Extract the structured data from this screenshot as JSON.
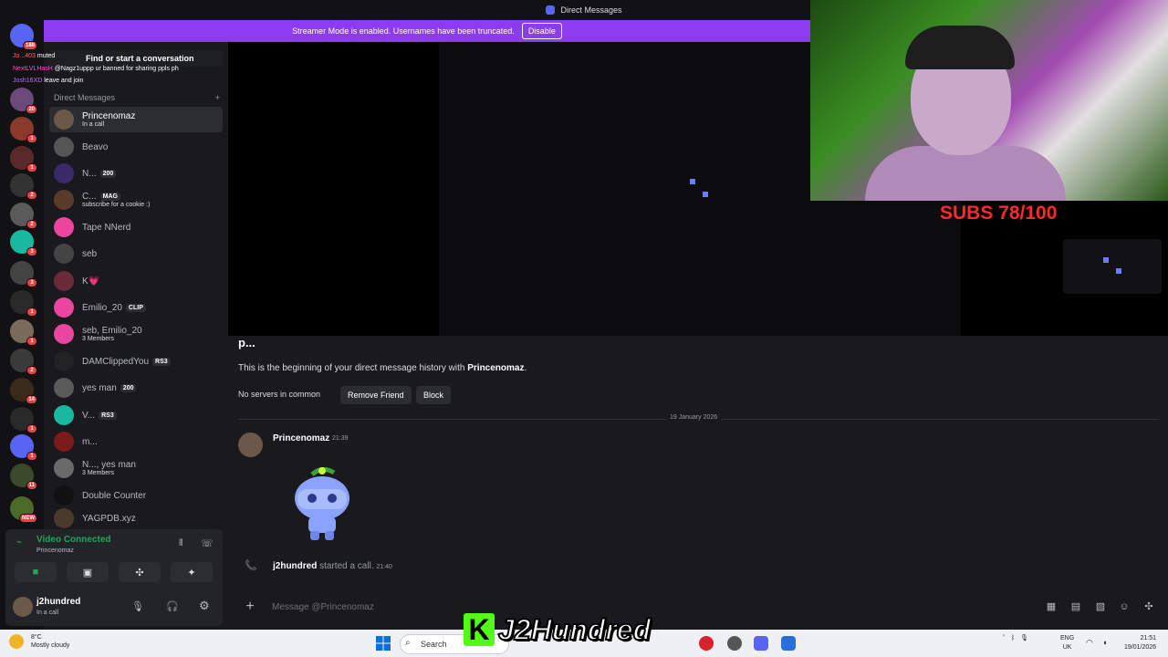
{
  "window": {
    "title": "Direct Messages"
  },
  "streamer_banner": {
    "text": "Streamer Mode is enabled. Usernames have been truncated.",
    "button": "Disable",
    "color": "#8c3bf0"
  },
  "rail": {
    "home_badge": "188",
    "servers": [
      {
        "badge": "20",
        "color": "#6b4a7a"
      },
      {
        "badge": "1",
        "color": "#8a3a2a"
      },
      {
        "badge": "1",
        "color": "#5a2a2a"
      },
      {
        "badge": "2",
        "color": "#333333"
      },
      {
        "badge": "2",
        "color": "#5a5a5a"
      },
      {
        "badge": "3",
        "color": "#19b8a0"
      },
      {
        "badge": "3",
        "color": "#444444"
      },
      {
        "badge": "1",
        "color": "#2a2a2a"
      },
      {
        "badge": "1",
        "color": "#7a6a5a"
      },
      {
        "badge": "2",
        "color": "#3a3a3a"
      },
      {
        "badge": "14",
        "color": "#3a2a1a"
      },
      {
        "badge": "1",
        "color": "#2a2a2a"
      },
      {
        "badge": "1",
        "color": "#5865f2"
      },
      {
        "badge": "11",
        "color": "#3a4a2a"
      },
      {
        "badge": "NEW",
        "color": "#4a6a2a"
      }
    ]
  },
  "chat_overlay": [
    {
      "user": "Jo...403",
      "msg": "muted"
    },
    {
      "user": "NextLVLHasH",
      "msg": "@Nagz1uppp ur banned for sharing ppls ph"
    },
    {
      "user": "Josh16XD",
      "msg": "leave and join"
    }
  ],
  "sidebar": {
    "find_conversation": "Find or start a conversation",
    "dm_header": "Direct Messages",
    "dms": [
      {
        "name": "Princenomaz",
        "sub": "In a call",
        "tag": "",
        "active": true,
        "color": "#6b5848"
      },
      {
        "name": "Beavo",
        "sub": "",
        "tag": "",
        "active": false,
        "color": "#555555"
      },
      {
        "name": "N...",
        "sub": "",
        "tag": "200",
        "active": false,
        "color": "#3a2a6a"
      },
      {
        "name": "C...",
        "sub": "subscribe for a cookie :)",
        "tag": "MAG",
        "active": false,
        "color": "#5a3a2a"
      },
      {
        "name": "Tape NNerd",
        "sub": "",
        "tag": "",
        "active": false,
        "color": "#eb459f"
      },
      {
        "name": "seb",
        "sub": "",
        "tag": "",
        "active": false,
        "color": "#444444"
      },
      {
        "name": "K💗",
        "sub": "",
        "tag": "",
        "active": false,
        "color": "#6a2a3a"
      },
      {
        "name": "Emilio_20",
        "sub": "",
        "tag": "CLIP",
        "active": false,
        "color": "#eb459f"
      },
      {
        "name": "seb, Emilio_20",
        "sub": "3 Members",
        "tag": "",
        "active": false,
        "color": "#eb459f"
      },
      {
        "name": "DAMClippedYou",
        "sub": "",
        "tag": "RS3",
        "active": false,
        "color": "#222222"
      },
      {
        "name": "yes man",
        "sub": "",
        "tag": "200",
        "active": false,
        "color": "#5a5a5a"
      },
      {
        "name": "V...",
        "sub": "",
        "tag": "RS3",
        "active": false,
        "color": "#19b8a0"
      },
      {
        "name": "m...",
        "sub": "",
        "tag": "",
        "active": false,
        "color": "#7a1a1a"
      },
      {
        "name": "N..., yes man",
        "sub": "3 Members",
        "tag": "",
        "active": false,
        "color": "#6a6a6a"
      },
      {
        "name": "Double Counter",
        "sub": "",
        "tag": "",
        "active": false,
        "color": "#111111"
      },
      {
        "name": "YAGPDB.xyz",
        "sub": "",
        "tag": "",
        "active": false,
        "color": "#4a3a2a"
      }
    ]
  },
  "voice": {
    "status": "Video Connected",
    "channel": "Princenomaz"
  },
  "user": {
    "name": "j2hundred",
    "status": "In a call"
  },
  "stream": {
    "subs_text": "SUBS 78/100"
  },
  "conversation": {
    "name": "p...",
    "intro_prefix": "This is the beginning of your direct message history with ",
    "intro_name": "Princenomaz",
    "intro_suffix": ".",
    "no_servers": "No servers in common",
    "remove_friend": "Remove Friend",
    "block": "Block",
    "date_divider": "19 January 2026",
    "message_author": "Princenomaz",
    "message_time": "21:39",
    "call_user": "j2hundred",
    "call_text": " started a call.",
    "call_time": "21:40",
    "composer_placeholder": "Message @Princenomaz"
  },
  "taskbar": {
    "temp": "8°C",
    "weather": "Mostly cloudy",
    "search": "Search",
    "logo": "J2Hundred",
    "lang1": "ENG",
    "lang2": "UK",
    "time": "21:51",
    "date": "19/01/2026"
  }
}
